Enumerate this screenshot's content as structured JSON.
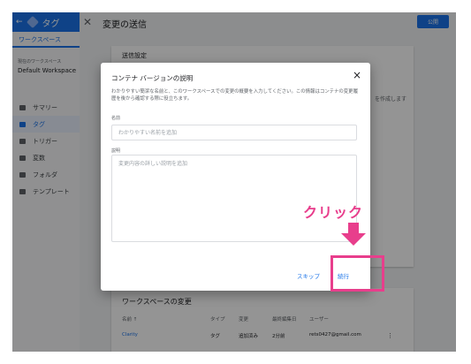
{
  "header": {
    "app_name": "タグ",
    "page_title": "変更の送信",
    "publish_label": "公開"
  },
  "sidebar": {
    "workspace_tab": "ワークスペース",
    "workspace_label": "現在のワークスペース",
    "workspace_name": "Default Workspace",
    "items": [
      {
        "label": "サマリー",
        "icon": "summary-icon",
        "active": false
      },
      {
        "label": "タグ",
        "icon": "tag-icon",
        "active": true
      },
      {
        "label": "トリガー",
        "icon": "trigger-icon",
        "active": false
      },
      {
        "label": "変数",
        "icon": "variable-icon",
        "active": false
      },
      {
        "label": "フォルダ",
        "icon": "folder-icon",
        "active": false
      },
      {
        "label": "テンプレート",
        "icon": "template-icon",
        "active": false
      }
    ]
  },
  "settings_card": {
    "title": "送信設定",
    "note": "を作成します"
  },
  "changes_card": {
    "title": "ワークスペースの変更",
    "columns": [
      "名前 ↑",
      "タイプ",
      "変更",
      "最終編集日",
      "ユーザー"
    ],
    "rows": [
      {
        "name": "Clarity",
        "type": "タグ",
        "change": "追加済み",
        "edited": "2分前",
        "user": "rets0427@gmail.com"
      }
    ]
  },
  "dialog": {
    "title": "コンテナ バージョンの説明",
    "description": "わかりやすい簡潔な名前と、このワークスペースでの変更の概要を入力してください。この情報はコンテナの変更履歴を後から確認する際に役立ちます。",
    "name_label": "名前",
    "name_placeholder": "わかりやすい名前を追加",
    "desc_label": "説明",
    "desc_placeholder": "変更内容の詳しい説明を追加",
    "skip_label": "スキップ",
    "continue_label": "続行"
  },
  "annotation": {
    "click_label": "クリック",
    "color": "#e83e8c"
  }
}
